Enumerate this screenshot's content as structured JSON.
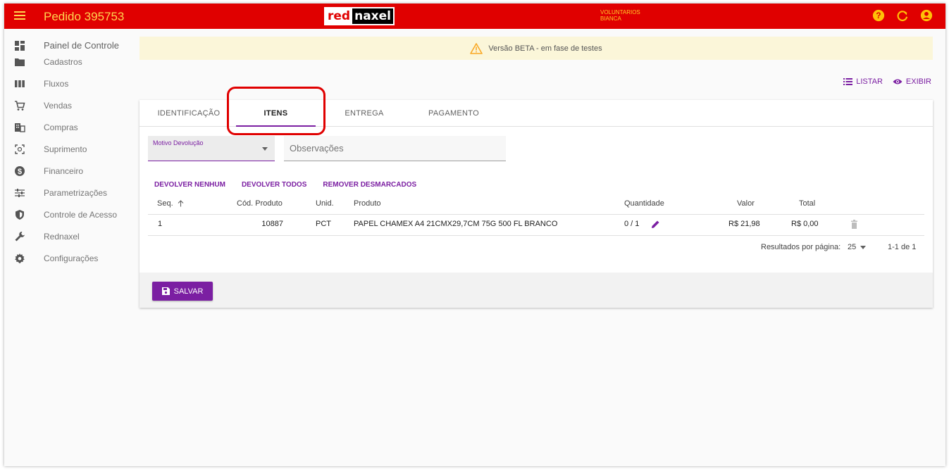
{
  "header": {
    "title": "Pedido 395753",
    "logo_part1": "red",
    "logo_part2": "naxel",
    "user_line1": "VOLUNTARIOS",
    "user_line2": "BIANCA"
  },
  "sidebar": {
    "items": [
      {
        "label": "Painel de Controle",
        "icon": "dashboard-icon"
      },
      {
        "label": "Cadastros",
        "icon": "folder-icon"
      },
      {
        "label": "Fluxos",
        "icon": "columns-icon"
      },
      {
        "label": "Vendas",
        "icon": "cart-icon"
      },
      {
        "label": "Compras",
        "icon": "building-icon"
      },
      {
        "label": "Suprimento",
        "icon": "scan-icon"
      },
      {
        "label": "Financeiro",
        "icon": "dollar-icon"
      },
      {
        "label": "Parametrizações",
        "icon": "sliders-icon"
      },
      {
        "label": "Controle de Acesso",
        "icon": "shield-icon"
      },
      {
        "label": "Rednaxel",
        "icon": "wrench-icon"
      },
      {
        "label": "Configurações",
        "icon": "gear-icon"
      }
    ]
  },
  "beta_banner": "Versão BETA - em fase de testes",
  "actions": {
    "list": "LISTAR",
    "show": "EXIBIR"
  },
  "tabs": [
    {
      "label": "IDENTIFICAÇÃO",
      "active": false
    },
    {
      "label": "ITENS",
      "active": true
    },
    {
      "label": "ENTREGA",
      "active": false
    },
    {
      "label": "PAGAMENTO",
      "active": false
    }
  ],
  "form": {
    "motivo_label": "Motivo Devolução",
    "motivo_value": "",
    "obs_placeholder": "Observações",
    "obs_value": ""
  },
  "bulk_actions": {
    "none": "DEVOLVER NENHUM",
    "all": "DEVOLVER TODOS",
    "remove": "REMOVER DESMARCADOS"
  },
  "table": {
    "headers": {
      "seq": "Seq.",
      "codigo": "Cód. Produto",
      "unid": "Unid.",
      "produto": "Produto",
      "quantidade": "Quantidade",
      "valor": "Valor",
      "total": "Total"
    },
    "rows": [
      {
        "seq": "1",
        "codigo": "10887",
        "unid": "PCT",
        "produto": "PAPEL CHAMEX A4 21CMX29,7CM 75G 500 FL BRANCO",
        "quantidade": "0 / 1",
        "valor": "R$ 21,98",
        "total": "R$ 0,00"
      }
    ],
    "pagination": {
      "label": "Resultados por página:",
      "per_page": "25",
      "range": "1-1 de 1"
    }
  },
  "save_label": "SALVAR",
  "colors": {
    "topbar": "#e00000",
    "accent": "#7b1fa2",
    "title": "#ffd54f"
  }
}
